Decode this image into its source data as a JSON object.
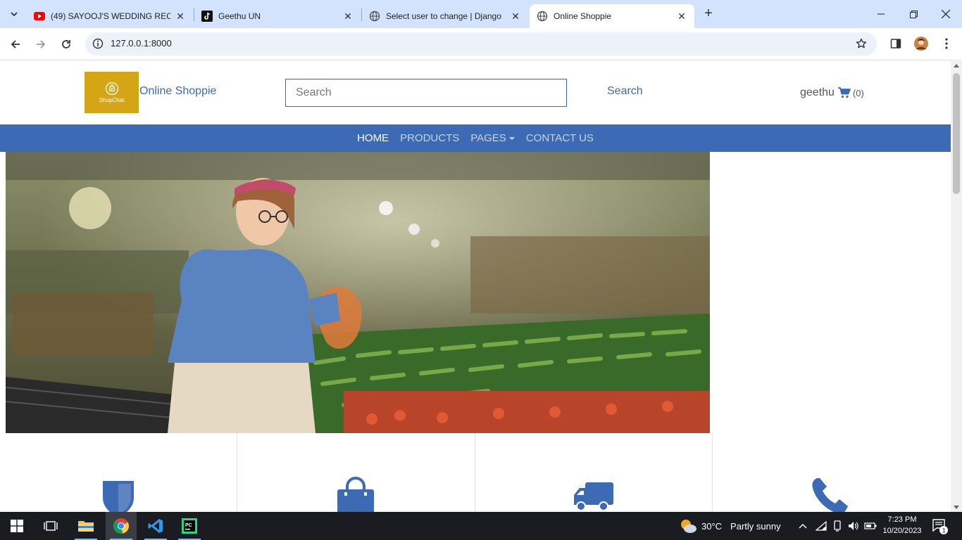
{
  "browser": {
    "tabs": [
      {
        "title": "(49) SAYOOJ'S WEDDING RECE"
      },
      {
        "title": "Geethu UN"
      },
      {
        "title": "Select user to change | Django"
      },
      {
        "title": "Online Shoppie"
      }
    ],
    "url": "127.0.0.1:8000"
  },
  "header": {
    "logo_text": "ShopChat",
    "brand": "Online Shoppie",
    "search_placeholder": "Search",
    "search_button": "Search",
    "username": "geethu",
    "cart_count": "(0)"
  },
  "nav": {
    "items": [
      "HOME",
      "PRODUCTS",
      "PAGES",
      "CONTACT US"
    ]
  },
  "features": {
    "icons": [
      "shield-icon",
      "shopping-bag-icon",
      "truck-icon",
      "phone-icon"
    ]
  },
  "taskbar": {
    "weather_temp": "30°C",
    "weather_desc": "Partly sunny",
    "time": "7:23 PM",
    "date": "10/20/2023",
    "notification_count": "1"
  },
  "colors": {
    "primary": "#3c6ab5",
    "logo_bg": "#d4a514"
  }
}
